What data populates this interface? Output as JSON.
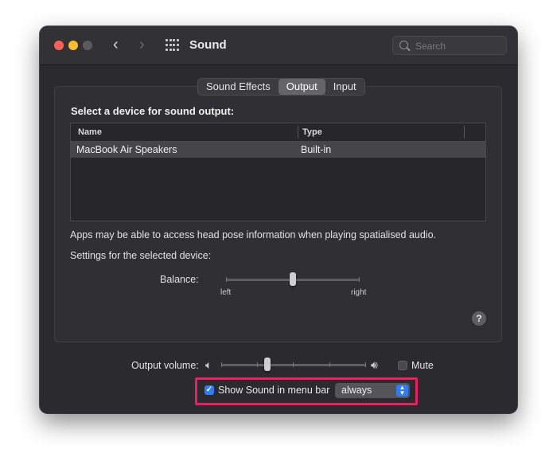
{
  "window": {
    "title": "Sound",
    "search_placeholder": "Search"
  },
  "tabs": [
    {
      "label": "Sound Effects",
      "active": false
    },
    {
      "label": "Output",
      "active": true
    },
    {
      "label": "Input",
      "active": false
    }
  ],
  "output": {
    "heading": "Select a device for sound output:",
    "table": {
      "columns": [
        "Name",
        "Type"
      ],
      "rows": [
        {
          "name": "MacBook Air Speakers",
          "type": "Built-in",
          "selected": true
        }
      ]
    },
    "spatial_info": "Apps may be able to access head pose information when playing spatialised audio.",
    "settings_label": "Settings for the selected device:",
    "balance": {
      "label": "Balance:",
      "left_label": "left",
      "right_label": "right",
      "value": 0.5
    }
  },
  "bottom": {
    "volume_label": "Output volume:",
    "volume_value": 0.3,
    "mute_label": "Mute",
    "mute_checked": false,
    "show_in_menubar_label": "Show Sound in menu bar",
    "show_in_menubar_checked": true,
    "menubar_option": "always"
  },
  "colors": {
    "accent": "#2f7cf6",
    "highlight_annotation": "#ee1c61"
  }
}
